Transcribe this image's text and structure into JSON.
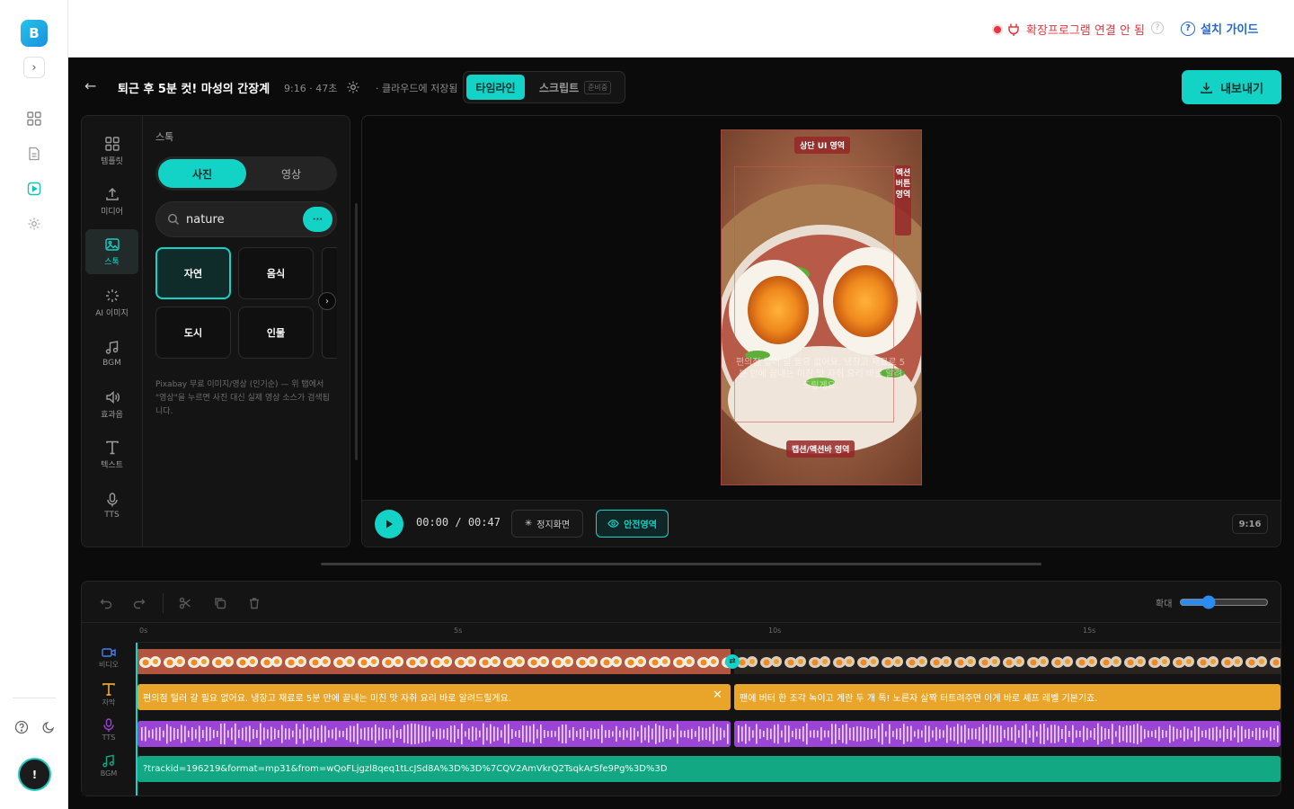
{
  "rail": {
    "logo_letter": "B",
    "avatar_letter": "!"
  },
  "topbar": {
    "ext_status": "확장프로그램 연결 안 됨",
    "help_small": "?",
    "guide_label": "설치 가이드"
  },
  "project": {
    "title": "퇴근 후 5분 컷! 마성의 간장계란",
    "meta": "9:16 · 47초",
    "saved": "· 클라우드에 저장됨",
    "tabs": [
      {
        "label": "타임라인"
      },
      {
        "label": "스크립트",
        "badge": "준비중"
      }
    ],
    "export_label": "내보내기"
  },
  "tools": [
    {
      "label": "템플릿",
      "icon": "template-grid-icon"
    },
    {
      "label": "미디어",
      "icon": "upload-icon"
    },
    {
      "label": "스톡",
      "icon": "image-icon"
    },
    {
      "label": "AI 이미지",
      "icon": "sparkle-icon"
    },
    {
      "label": "BGM",
      "icon": "music-note-icon"
    },
    {
      "label": "효과음",
      "icon": "speaker-icon"
    },
    {
      "label": "텍스트",
      "icon": "text-t-icon"
    },
    {
      "label": "TTS",
      "icon": "microphone-icon"
    }
  ],
  "stock": {
    "heading": "스톡",
    "seg": [
      "사진",
      "영상"
    ],
    "search_value": "nature",
    "search_btn": "···",
    "chips": [
      "자연",
      "음식",
      "도시",
      "인물"
    ],
    "note": "Pixabay 무료 이미지/영상 (인기순) — 위 탭에서 \"영상\"을 누르면 사진 대신 실제 영상 소스가 검색됩니다."
  },
  "preview": {
    "label_top": "상단 UI 영역",
    "label_side": "액션버튼영역",
    "label_bottom": "캡션/액션바 영역",
    "caption_overlay": "편의점 털러 갈 필요 없어요. 냉장고 재료로 5분 만에 끝내는 미친 맛 자취 요리 바로 알려드릴게요.",
    "time_current": "00:00",
    "time_sep": "/",
    "time_total": "00:47",
    "still_label": "정지화면",
    "safe_label": "안전영역",
    "ratio": "9:16"
  },
  "timeline": {
    "zoom_label": "확대",
    "zoom_value": 30,
    "ticks": [
      "0s",
      "5s",
      "10s",
      "15s"
    ],
    "tracks": [
      "비디오",
      "자막",
      "TTS",
      "BGM"
    ],
    "captions": [
      "편의점 털러 갈 필요 없어요. 냉장고 재료로 5분 만에 끝내는 미친 맛 자취 요리 바로 알려드릴게요.",
      "팬에 버터 한 조각 녹이고 계란 두 개 톡! 노른자 살짝 터트려주면 이게 바로 셰프 레벨 기본기죠."
    ],
    "bgm_text": "?trackid=196219&format=mp31&from=wQoFLjgzl8qeq1tLcJSd8A%3D%3D%7CQV2AmVkrQ2TsqkArSfe9Pg%3D%3D"
  },
  "colors": {
    "accent": "#12d3c6",
    "caption": "#e9a52a",
    "tts": "#9a45d6",
    "bgm": "#13a884",
    "warn": "#e5353f",
    "link": "#2466d9"
  }
}
